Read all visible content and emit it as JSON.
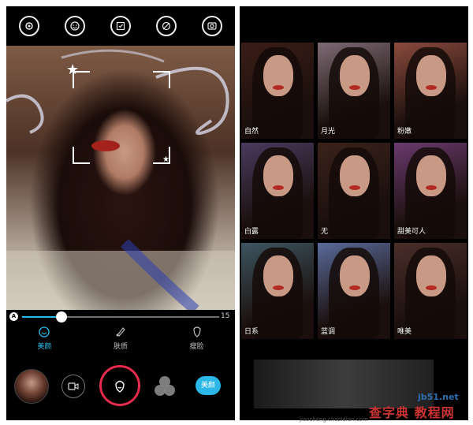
{
  "camera": {
    "slider": {
      "min_label": "A",
      "max_label": "15",
      "value_fraction": 0.2
    },
    "tabs": [
      {
        "label": "美颜",
        "icon": "face-smile-icon",
        "active": true
      },
      {
        "label": "肤质",
        "icon": "brush-icon",
        "active": false
      },
      {
        "label": "瘦脸",
        "icon": "face-slim-icon",
        "active": false
      }
    ],
    "toolbar_icons": [
      "settings-icon",
      "face-icon",
      "timer-icon",
      "flash-icon",
      "switch-camera-icon"
    ],
    "beauty_button_label": "美颜"
  },
  "filters": {
    "items": [
      {
        "label": "自然",
        "tone": "#3b1d17"
      },
      {
        "label": "月光",
        "tone": "#7d6b74"
      },
      {
        "label": "粉嫩",
        "tone": "#8a4a3d"
      },
      {
        "label": "白露",
        "tone": "#4a3a5e"
      },
      {
        "label": "无",
        "tone": "#3a221b"
      },
      {
        "label": "甜美可人",
        "tone": "#6a3a6e",
        "selected": true
      },
      {
        "label": "日系",
        "tone": "#3d5560"
      },
      {
        "label": "蓝调",
        "tone": "#5a6a9a"
      },
      {
        "label": "唯美",
        "tone": "#4a2e2a"
      }
    ]
  },
  "watermark": {
    "site": "jb51.net",
    "title": "查字典 教程网",
    "domain": "jiaocheng.chazidian.com"
  },
  "colors": {
    "accent": "#2bb8e8",
    "shutter_ring": "#e62a4a"
  }
}
